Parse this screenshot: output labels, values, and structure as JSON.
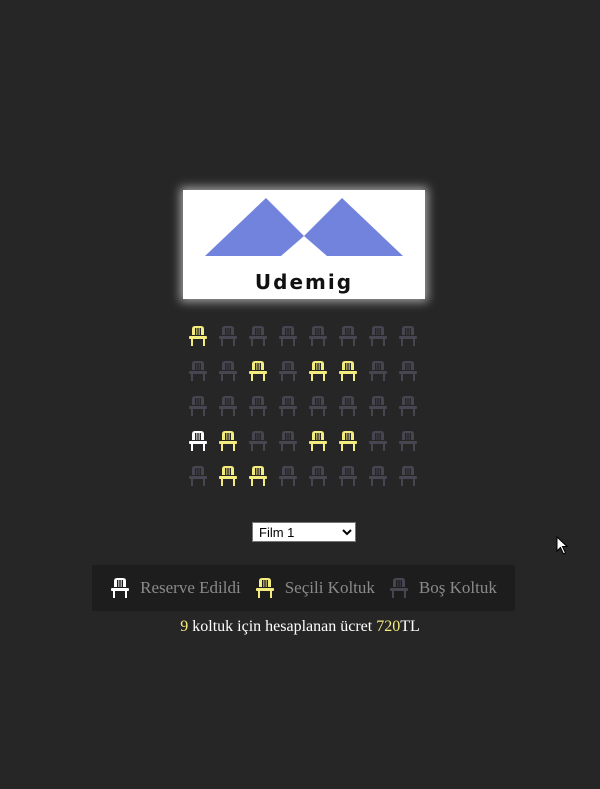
{
  "brand": {
    "name": "Udemig",
    "accent": "#7283dd"
  },
  "colors": {
    "occupied": "#ffffff",
    "selected": "#f5ec7e",
    "empty": "#474550",
    "background": "#272627"
  },
  "seats": [
    [
      "selected",
      "empty",
      "empty",
      "empty",
      "empty",
      "empty",
      "empty",
      "empty"
    ],
    [
      "empty",
      "empty",
      "selected",
      "empty",
      "selected",
      "selected",
      "empty",
      "empty"
    ],
    [
      "empty",
      "empty",
      "empty",
      "empty",
      "empty",
      "empty",
      "empty",
      "empty"
    ],
    [
      "occupied",
      "selected",
      "empty",
      "empty",
      "selected",
      "selected",
      "empty",
      "empty"
    ],
    [
      "empty",
      "selected",
      "selected",
      "empty",
      "empty",
      "empty",
      "empty",
      "empty"
    ]
  ],
  "movie_select": {
    "selected": "Film 1"
  },
  "legend": {
    "occupied_label": "Reserve Edildi",
    "selected_label": "Seçili Koltuk",
    "empty_label": "Boş Koltuk"
  },
  "summary": {
    "count": "9",
    "middle_text": " koltuk için hesaplanan ücret ",
    "price": "720",
    "currency": "TL"
  }
}
